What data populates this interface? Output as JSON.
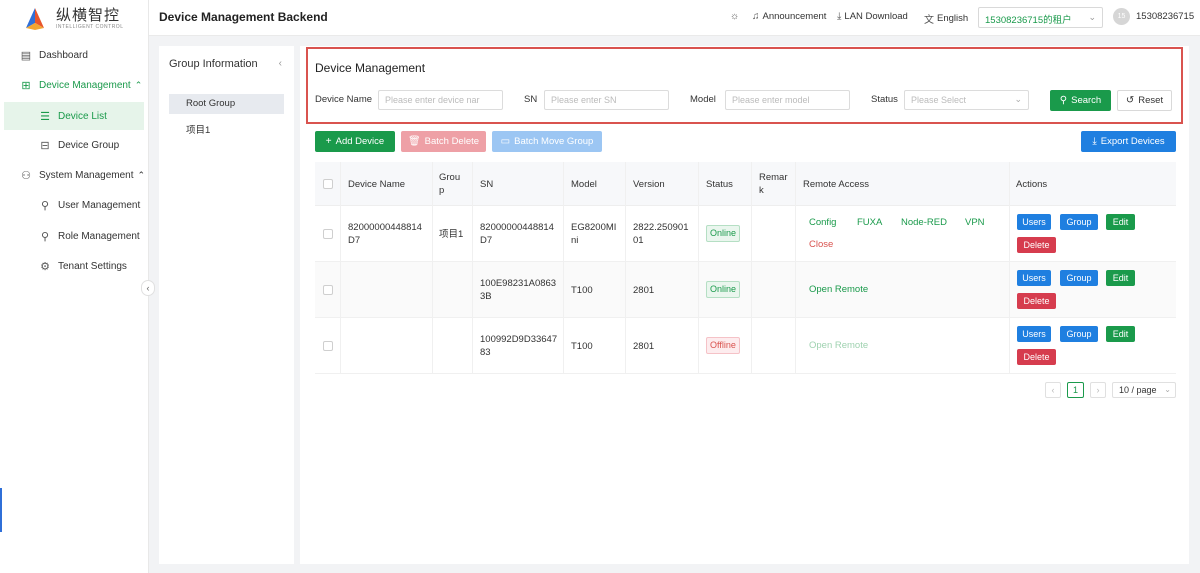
{
  "logo": {
    "cn": "纵横智控",
    "en": "INTELLIGENT CONTROL"
  },
  "sidebar": {
    "items": [
      {
        "label": "Dashboard",
        "icon": "dashboard-icon"
      },
      {
        "label": "Device Management",
        "icon": "device-management-icon"
      },
      {
        "label": "Device List",
        "icon": "list-icon"
      },
      {
        "label": "Device Group",
        "icon": "device-group-icon"
      },
      {
        "label": "System Management",
        "icon": "system-management-icon"
      },
      {
        "label": "User Management",
        "icon": "user-icon"
      },
      {
        "label": "Role Management",
        "icon": "role-icon"
      },
      {
        "label": "Tenant Settings",
        "icon": "gear-icon"
      }
    ]
  },
  "header": {
    "title": "Device Management Backend",
    "announcement": "Announcement",
    "lan_download": "LAN Download",
    "language": "English",
    "tenant": "15308236715的租户",
    "avatar_initials": "15",
    "username": "15308236715"
  },
  "group_panel": {
    "title": "Group Information",
    "items": [
      "Root Group",
      "项目1"
    ]
  },
  "filter": {
    "title": "Device Management",
    "device_name_label": "Device Name",
    "device_name_placeholder": "Please enter device nar",
    "sn_label": "SN",
    "sn_placeholder": "Please enter SN",
    "model_label": "Model",
    "model_placeholder": "Please enter model",
    "status_label": "Status",
    "status_placeholder": "Please Select",
    "search_label": "Search",
    "reset_label": "Reset"
  },
  "toolbar": {
    "add_device": "Add Device",
    "batch_delete": "Batch Delete",
    "batch_move_group": "Batch Move Group",
    "export_devices": "Export Devices"
  },
  "table": {
    "headers": {
      "device_name": "Device Name",
      "group_l1": "Grou",
      "group_l2": "p",
      "sn": "SN",
      "model": "Model",
      "version": "Version",
      "status": "Status",
      "remark_l1": "Remar",
      "remark_l2": "k",
      "remote_access": "Remote Access",
      "actions": "Actions"
    },
    "rows": [
      {
        "name_l1": "82000000448814",
        "name_l2": "D7",
        "group": "项目1",
        "sn_l1": "82000000448814",
        "sn_l2": "D7",
        "model_l1": "EG8200MI",
        "model_l2": "ni",
        "version_l1": "2822.250901",
        "version_l2": "01",
        "status": "Online",
        "remote": {
          "config": "Config",
          "fuxa": "FUXA",
          "nodered": "Node-RED",
          "vpn": "VPN",
          "close": "Close"
        }
      },
      {
        "name_l1": "",
        "name_l2": "",
        "group": "",
        "sn_l1": "100E98231A0863",
        "sn_l2": "3B",
        "model_l1": "T100",
        "model_l2": "",
        "version_l1": "2801",
        "version_l2": "",
        "status": "Online",
        "remote": {
          "open": "Open Remote"
        }
      },
      {
        "name_l1": "",
        "name_l2": "",
        "group": "",
        "sn_l1": "100992D9D33647",
        "sn_l2": "83",
        "model_l1": "T100",
        "model_l2": "",
        "version_l1": "2801",
        "version_l2": "",
        "status": "Offline",
        "remote": {
          "open": "Open Remote"
        }
      }
    ],
    "actions": {
      "users": "Users",
      "group": "Group",
      "edit": "Edit",
      "delete": "Delete"
    }
  },
  "pagination": {
    "current": "1",
    "page_size": "10 / page"
  },
  "colors": {
    "brand_green": "#1a9a4b",
    "action_blue": "#1f7fe0",
    "danger_red": "#d63c4e",
    "highlight_border": "#d9534f"
  }
}
